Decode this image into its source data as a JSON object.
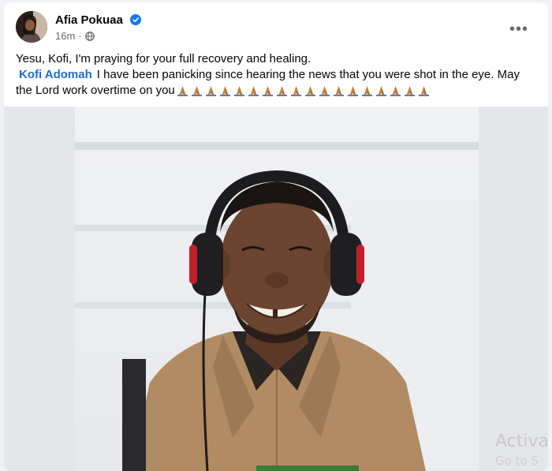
{
  "post": {
    "author": "Afia Pokuaa",
    "time": "16m",
    "separator": "·",
    "more_label": "•••",
    "text_line1": "Yesu, Kofi, I'm praying for your full recovery and healing.",
    "mention": "Kofi Adomah",
    "text_line2": "I have been panicking since hearing the news that you were shot in the eye. May the Lord work overtime on you",
    "emoji": "folded-hands",
    "emoji_count": 18
  },
  "watermark": {
    "line1": "Activa",
    "line2": "Go to S"
  },
  "colors": {
    "mention": "#1f6dcf",
    "verified": "#1877f2",
    "meta": "#65676b"
  },
  "icons": [
    "verified-badge-icon",
    "globe-icon",
    "more-options-icon",
    "folded-hands-emoji"
  ]
}
